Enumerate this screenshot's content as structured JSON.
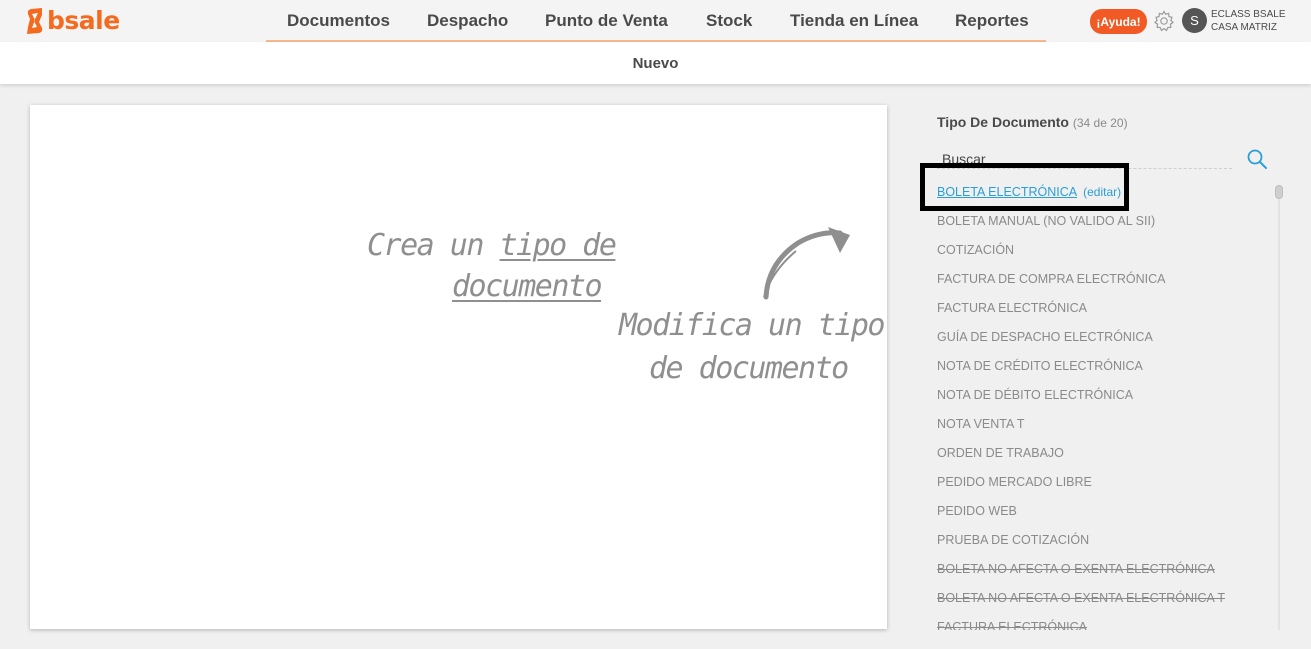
{
  "brand": {
    "name": "bsale",
    "color": "#f46a1f"
  },
  "nav": {
    "items": [
      {
        "label": "Documentos"
      },
      {
        "label": "Despacho"
      },
      {
        "label": "Punto de Venta"
      },
      {
        "label": "Stock"
      },
      {
        "label": "Tienda en Línea"
      },
      {
        "label": "Reportes"
      }
    ]
  },
  "header": {
    "help_label": "¡Ayuda!",
    "help_color": "#f15a24",
    "settings_icon": "gear-icon",
    "avatar_initial": "S",
    "company_name": "ECLASS BSALE",
    "branch_name": "CASA MATRIZ"
  },
  "subnav": {
    "label": "Nuevo"
  },
  "main": {
    "hint_create_prefix": "Crea un",
    "hint_create_link1": "tipo de",
    "hint_create_link2": "documento",
    "hint_modify_line1": "Modifica un tipo",
    "hint_modify_line2": "de documento"
  },
  "sidebar": {
    "title": "Tipo De Documento",
    "count": "(34 de 20)",
    "search_placeholder": "Buscar",
    "search_icon": "search-icon",
    "edit_label": "(editar)",
    "items": [
      {
        "label": "BOLETA ELECTRÓNICA",
        "state": "active"
      },
      {
        "label": "BOLETA MANUAL (NO VALIDO AL SII)",
        "state": "normal"
      },
      {
        "label": "COTIZACIÓN",
        "state": "normal"
      },
      {
        "label": "FACTURA DE COMPRA ELECTRÓNICA",
        "state": "normal"
      },
      {
        "label": "FACTURA ELECTRÓNICA",
        "state": "normal"
      },
      {
        "label": "GUÍA DE DESPACHO ELECTRÓNICA",
        "state": "normal"
      },
      {
        "label": "NOTA DE CRÉDITO ELECTRÓNICA",
        "state": "normal"
      },
      {
        "label": "NOTA DE DÉBITO ELECTRÓNICA",
        "state": "normal"
      },
      {
        "label": "NOTA VENTA T",
        "state": "normal"
      },
      {
        "label": "ORDEN DE TRABAJO",
        "state": "normal"
      },
      {
        "label": "PEDIDO MERCADO LIBRE",
        "state": "normal"
      },
      {
        "label": "PEDIDO WEB",
        "state": "normal"
      },
      {
        "label": "PRUEBA DE COTIZACIÓN",
        "state": "normal"
      },
      {
        "label": "BOLETA NO AFECTA O EXENTA ELECTRÓNICA",
        "state": "disabled"
      },
      {
        "label": "BOLETA NO AFECTA O EXENTA ELECTRÓNICA T",
        "state": "disabled"
      },
      {
        "label": "FACTURA ELECTRÓNICA",
        "state": "disabled"
      }
    ]
  }
}
